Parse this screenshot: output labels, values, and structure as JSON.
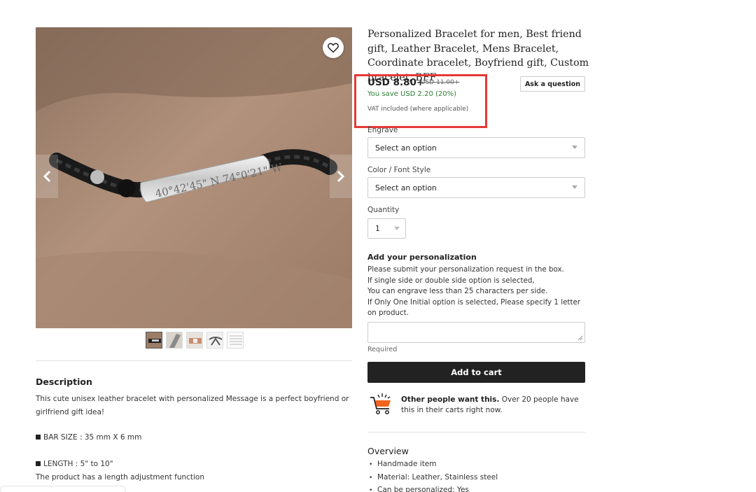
{
  "product": {
    "title": "Personalized Bracelet for men, Best friend gift, Leather Bracelet, Mens Bracelet, Coordinate bracelet, Boyfriend gift, Custom bracelet, BFF",
    "engraving_text": "40°42'45\" N 74°0'21\" W",
    "price": "USD 8.80+",
    "price_original": "USD 11.00+",
    "savings": "You save USD 2.20 (20%)",
    "vat_note": "VAT included (where applicable)",
    "ask_question_label": "Ask a question"
  },
  "options": {
    "engrave_label": "Engrave",
    "engrave_placeholder": "Select an option",
    "color_label": "Color / Font Style",
    "color_placeholder": "Select an option",
    "quantity_label": "Quantity",
    "quantity_value": "1"
  },
  "personalization": {
    "title": "Add your personalization",
    "instructions": [
      "Please submit your personalization request in the box.",
      "If single side or double side option is selected,",
      "You can engrave less than 25 characters per side.",
      "If Only One Initial option is selected, Please specify 1 letter on product."
    ],
    "required_label": "Required"
  },
  "cart": {
    "add_to_cart_label": "Add to cart",
    "social_proof_bold": "Other people want this.",
    "social_proof_rest": " Over 20 people have this in their carts right now."
  },
  "overview": {
    "title": "Overview",
    "items": [
      "Handmade item",
      "Material: Leather, Stainless steel",
      "Can be personalized: Yes"
    ]
  },
  "description": {
    "title": "Description",
    "intro": "This cute unisex leather bracelet with personalized Message is a perfect boyfriend or girlfriend gift idea!",
    "bar_size": "BAR SIZE : 35 mm X 6 mm",
    "length": "LENGTH : 5\" to 10\"",
    "adjust_note": "The product has a length adjustment function"
  },
  "colors": {
    "highlight": "#e53935",
    "savings_green": "#2e7d32",
    "button_dark": "#222222"
  },
  "icons": [
    "heart-icon",
    "chevron-left-icon",
    "chevron-right-icon",
    "cart-icon"
  ]
}
